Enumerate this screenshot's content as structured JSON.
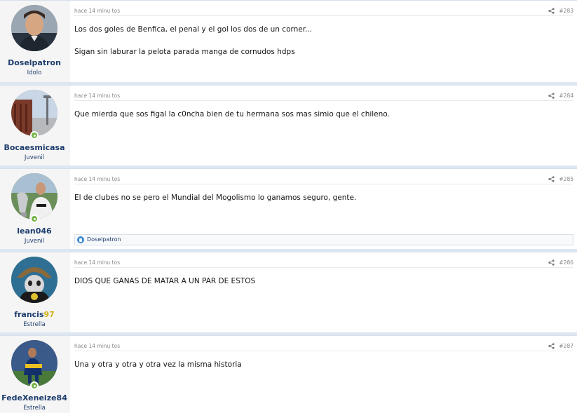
{
  "posts": [
    {
      "username": "Doselpatron",
      "user_title": "Idolo",
      "time": "hace 14 minu tos",
      "number": "#283",
      "body": "Los dos goles de Benfica, el penal y el gol los dos de un corner...\n\nSigan sin laburar la pelota parada manga de cornudos hdps",
      "online": false
    },
    {
      "username": "Bocaesmicasa",
      "user_title": "Juvenil",
      "time": "hace 14 minu tos",
      "number": "#284",
      "body": "Que mierda que sos figal la c0ncha bien de tu hermana sos mas simio que el chileno.",
      "online": true
    },
    {
      "username": "lean046",
      "user_title": "Juvenil",
      "time": "hace 14 minu tos",
      "number": "#285",
      "body": "El de clubes no se pero el Mundial del Mogolismo lo ganamos seguro, gente.",
      "online": true,
      "reaction_user": "Doselpatron"
    },
    {
      "username_part1": "francis",
      "username_part2": "97",
      "user_title": "Estrella",
      "time": "hace 14 minu tos",
      "number": "#286",
      "body": "DIOS QUE GANAS DE MATAR A UN PAR DE ESTOS",
      "online": false
    },
    {
      "username": "FedeXeneize84",
      "user_title": "Estrella",
      "time": "hace 14 minu tos",
      "number": "#287",
      "body": "Una y otra y otra y otra vez la misma historia",
      "online": true
    }
  ],
  "colors": {
    "username": "#1d3d6c",
    "online": "#72b344",
    "separator": "#dce7f3",
    "like": "#3a8ad6"
  },
  "icons": [
    "share-icon",
    "like-icon",
    "online-indicator"
  ]
}
